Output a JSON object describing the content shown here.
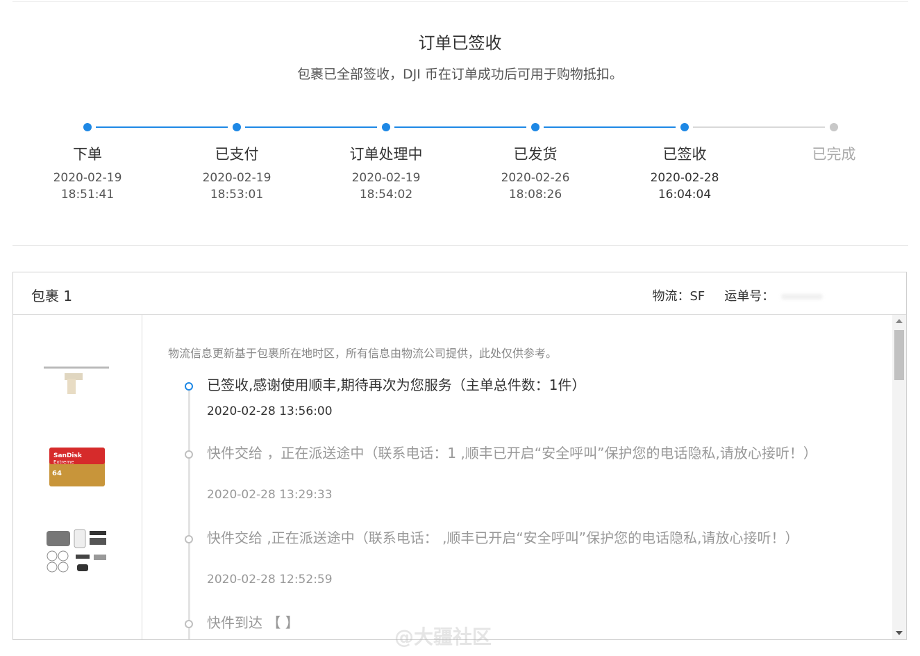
{
  "header": {
    "title": "订单已签收",
    "subtitle": "包裹已全部签收，DJI 币在订单成功后可用于购物抵扣。"
  },
  "steps": [
    {
      "label": "下单",
      "date": "2020-02-19",
      "time": "18:51:41",
      "done": true
    },
    {
      "label": "已支付",
      "date": "2020-02-19",
      "time": "18:53:01",
      "done": true
    },
    {
      "label": "订单处理中",
      "date": "2020-02-19",
      "time": "18:54:02",
      "done": true
    },
    {
      "label": "已发货",
      "date": "2020-02-26",
      "time": "18:08:26",
      "done": true
    },
    {
      "label": "已签收",
      "date": "2020-02-28",
      "time": "16:04:04",
      "done": true
    },
    {
      "label": "已完成",
      "date": "",
      "time": "",
      "done": false
    }
  ],
  "package": {
    "title": "包裹 1",
    "carrier_label": "物流：SF",
    "tracking_label": "运单号："
  },
  "logistics": {
    "notice": "物流信息更新基于包裹所在地时区，所有信息由物流公司提供，此处仅供参考。",
    "events": [
      {
        "text": "已签收,感谢使用顺丰,期待再次为您服务（主单总件数：1件）",
        "time": "2020-02-28 13:56:00",
        "active": true
      },
      {
        "text": "快件交给 ，正在派送途中（联系电话：1 ,顺丰已开启“安全呼叫”保护您的电话隐私,请放心接听！）",
        "time": "2020-02-28 13:29:33",
        "active": false
      },
      {
        "text": "快件交给 ,正在派送途中（联系电话： ,顺丰已开启“安全呼叫”保护您的电话隐私,请放心接听！）",
        "time": "2020-02-28 12:52:59",
        "active": false
      },
      {
        "text": "快件到达 【 】",
        "time": "",
        "active": false
      }
    ]
  },
  "colors": {
    "accent": "#1e88e5",
    "inactive": "#c8c8c8"
  },
  "watermark": "@大疆社区"
}
